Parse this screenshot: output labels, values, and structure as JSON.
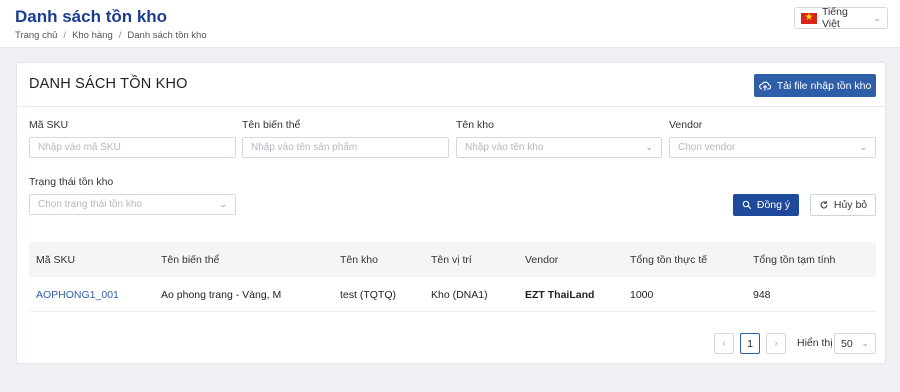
{
  "header": {
    "title": "Danh sách tồn kho",
    "breadcrumb": [
      "Trang chủ",
      "Kho hàng",
      "Danh sách tồn kho"
    ],
    "breadcrumb_sep": "/",
    "language": "Tiếng Việt"
  },
  "card": {
    "title": "DANH SÁCH TỒN KHO",
    "upload_button": "Tải file nhập tồn kho"
  },
  "filters": {
    "sku": {
      "label": "Mã SKU",
      "placeholder": "Nhập vào mã SKU"
    },
    "variant": {
      "label": "Tên biến thể",
      "placeholder": "Nhập vào tên sản phẩm"
    },
    "warehouse": {
      "label": "Tên kho",
      "placeholder": "Nhập vào tên kho"
    },
    "vendor": {
      "label": "Vendor",
      "placeholder": "Chọn vendor"
    },
    "status": {
      "label": "Trạng thái tồn kho",
      "placeholder": "Chọn trạng thái tồn kho"
    },
    "submit_button": "Đồng ý",
    "cancel_button": "Hủy bỏ"
  },
  "table": {
    "columns": [
      "Mã SKU",
      "Tên biến thể",
      "Tên kho",
      "Tên vị trí",
      "Vendor",
      "Tổng tồn thực tế",
      "Tổng tồn tạm tính"
    ],
    "rows": [
      [
        "AOPHONG1_001",
        "Ao phong trang - Vàng, M",
        "test (TQTQ)",
        "Kho (DNA1)",
        "EZT ThaiLand",
        "1000",
        "948"
      ]
    ]
  },
  "pagination": {
    "prev": "‹",
    "current_page": "1",
    "next": "›",
    "show_label": "Hiển thị",
    "page_size": "50"
  },
  "colors": {
    "accent": "#2f5ea8",
    "title_blue": "#1d3d8f"
  }
}
